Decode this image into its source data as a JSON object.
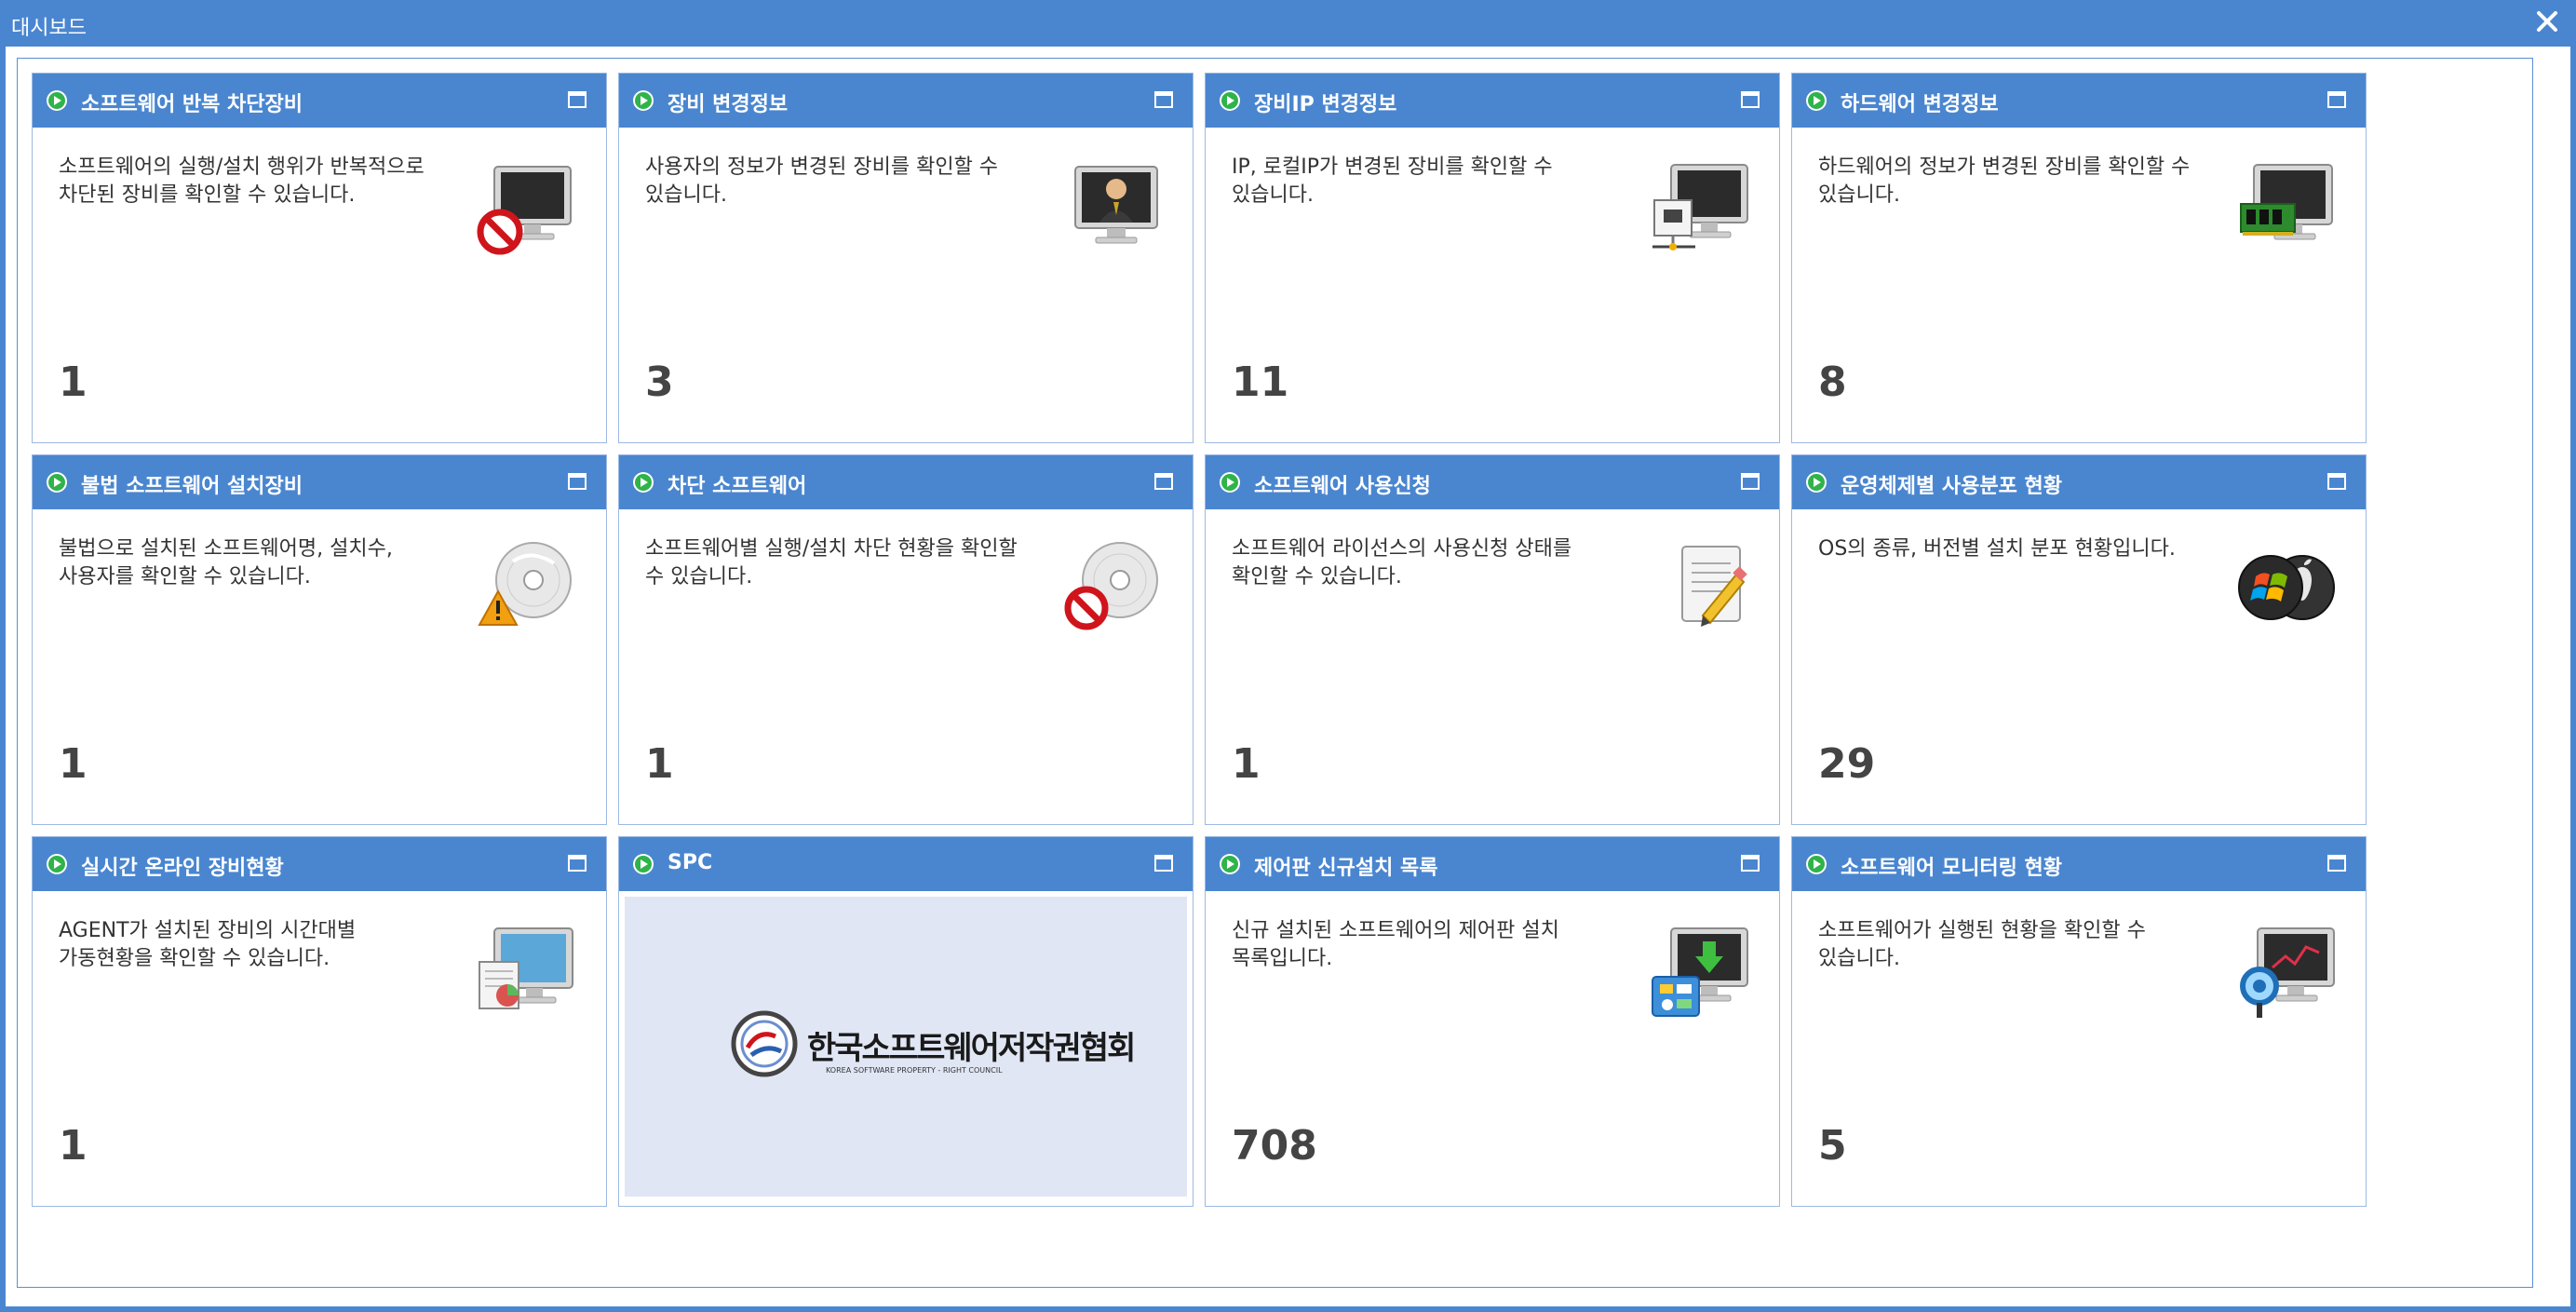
{
  "window": {
    "title": "대시보드",
    "close_icon": "close-icon"
  },
  "colors": {
    "header": "#4a86d0",
    "count": "#444444",
    "play": "#2fb34a"
  },
  "panels": [
    {
      "title": "소프트웨어 반복 차단장비",
      "desc": "소프트웨어의 실행/설치 행위가 반복적으로 차단된 장비를 확인할 수 있습니다.",
      "count": "1",
      "icon": "monitor-blocked-icon"
    },
    {
      "title": "장비 변경정보",
      "desc": "사용자의 정보가 변경된 장비를 확인할 수 있습니다.",
      "count": "3",
      "icon": "monitor-user-icon"
    },
    {
      "title": "장비IP 변경정보",
      "desc": "IP, 로컬IP가 변경된 장비를 확인할 수 있습니다.",
      "count": "11",
      "icon": "monitor-network-icon"
    },
    {
      "title": "하드웨어 변경정보",
      "desc": "하드웨어의 정보가 변경된 장비를 확인할 수 있습니다.",
      "count": "8",
      "icon": "monitor-memory-icon"
    },
    {
      "title": "불법 소프트웨어 설치장비",
      "desc": "불법으로 설치된 소프트웨어명, 설치수, 사용자를 확인할 수 있습니다.",
      "count": "1",
      "icon": "disc-warning-icon"
    },
    {
      "title": "차단 소프트웨어",
      "desc": "소프트웨어별 실행/설치 차단 현황을 확인할 수 있습니다.",
      "count": "1",
      "icon": "disc-blocked-icon"
    },
    {
      "title": "소프트웨어 사용신청",
      "desc": "소프트웨어 라이선스의 사용신청 상태를 확인할 수 있습니다.",
      "count": "1",
      "icon": "document-edit-icon"
    },
    {
      "title": "운영체제별 사용분포 현황",
      "desc": "OS의 종류, 버전별 설치 분포 현황입니다.",
      "count": "29",
      "icon": "os-logos-icon"
    },
    {
      "title": "실시간 온라인 장비현황",
      "desc": "AGENT가 설치된 장비의 시간대별 가동현황을 확인할 수 있습니다.",
      "count": "1",
      "icon": "monitor-chart-icon"
    },
    {
      "title": "SPC",
      "desc": "",
      "count": "",
      "icon": "spc-logo",
      "logo_text": "한국소프트웨어저작권협회",
      "logo_sub": "KOREA SOFTWARE PROPERTY - RIGHT COUNCIL"
    },
    {
      "title": "제어판 신규설치 목록",
      "desc": "신규 설치된 소프트웨어의 제어판 설치 목록입니다.",
      "count": "708",
      "icon": "monitor-download-icon"
    },
    {
      "title": "소프트웨어 모니터링 현황",
      "desc": "소프트웨어가 실행된 현황을 확인할 수 있습니다.",
      "count": "5",
      "icon": "monitor-magnifier-icon"
    }
  ]
}
